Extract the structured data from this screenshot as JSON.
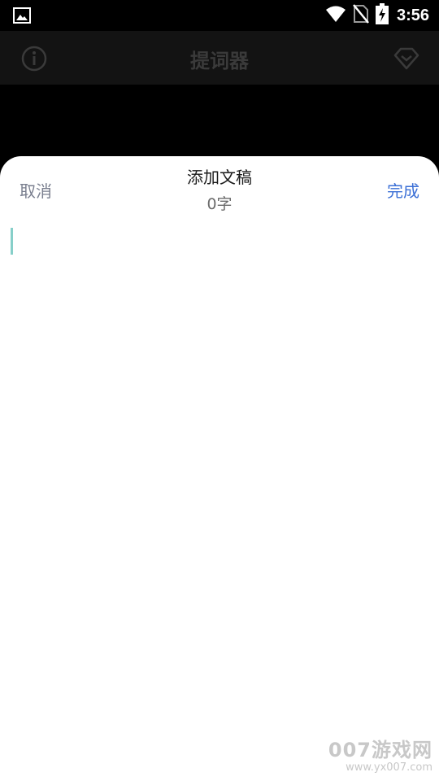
{
  "status_bar": {
    "time": "3:56",
    "icons": [
      "gallery-icon",
      "wifi-icon",
      "no-sim-icon",
      "battery-charging-icon"
    ]
  },
  "app_header": {
    "title": "提词器",
    "left_icon": "info-icon",
    "right_icon": "diamond-vip-icon"
  },
  "sheet": {
    "title": "添加文稿",
    "word_count": "0字",
    "cancel_label": "取消",
    "done_label": "完成",
    "editor_value": ""
  },
  "watermark": {
    "main": "007游戏网",
    "url": "www.yx007.com"
  },
  "colors": {
    "accent_done": "#3b6fd6",
    "cancel_text": "#7a7f8f",
    "caret": "#86cfc9"
  }
}
